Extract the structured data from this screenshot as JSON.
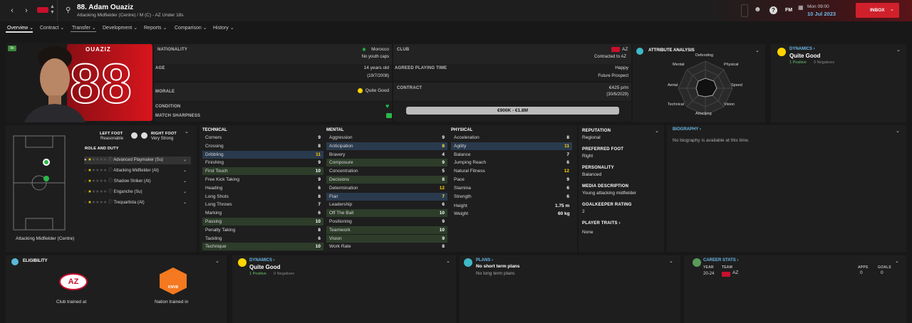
{
  "header": {
    "name": "88. Adam Ouaziz",
    "subtitle": "Attacking Midfielder (Centre) / M (C) - AZ Under 18s",
    "date_time": "Mon 09:00",
    "date": "10 Jul 2023",
    "inbox_label": "INBOX",
    "fm_label": "FM"
  },
  "nav": [
    "Overview",
    "Contract",
    "Transfer",
    "Development",
    "Reports",
    "Comparison",
    "History"
  ],
  "player_card": {
    "badge": "9s",
    "shirt_name": "OUAZIZ",
    "shirt_number": "88"
  },
  "info": {
    "nationality_label": "NATIONALITY",
    "nationality": "Morocco",
    "youth_caps": "No youth caps",
    "club_label": "CLUB",
    "club": "AZ",
    "contracted_to": "Contracted to AZ",
    "age_label": "AGE",
    "age": "14 years old",
    "dob": "(19/7/2008)",
    "playing_time_label": "AGREED PLAYING TIME",
    "playing_time": "Happy",
    "playing_time_sub": "Future Prospect",
    "morale_label": "MORALE",
    "morale": "Quite Good",
    "contract_label": "CONTRACT",
    "wage": "€425 p/m",
    "contract_end": "(30/6/2029)",
    "condition_label": "CONDITION",
    "sharpness_label": "MATCH SHARPNESS",
    "value": "€900K - €1.8M"
  },
  "attribute_analysis": {
    "title": "ATTRIBUTE ANALYSIS",
    "labels": [
      "Defending",
      "Physical",
      "Speed",
      "Vision",
      "Attacking",
      "Technical",
      "Aerial",
      "Mental"
    ]
  },
  "dynamics_top": {
    "title": "DYNAMICS",
    "value": "Quite Good",
    "positive": "1 Positive",
    "negatives": "0 Negatives"
  },
  "positions": {
    "left_foot_label": "LEFT FOOT",
    "left_foot": "Reasonable",
    "right_foot_label": "RIGHT FOOT",
    "right_foot": "Very Strong",
    "role_label": "ROLE AND DUTY",
    "roles": [
      "Advanced Playmaker (Su)",
      "Attacking Midfielder (At)",
      "Shadow Striker (At)",
      "Enganche (Su)",
      "Trequartista (At)"
    ],
    "position_name": "Attacking Midfielder (Centre)"
  },
  "technical": {
    "title": "TECHNICAL",
    "rows": [
      {
        "name": "Corners",
        "value": "9"
      },
      {
        "name": "Crossing",
        "value": "8"
      },
      {
        "name": "Dribbling",
        "value": "11"
      },
      {
        "name": "Finishing",
        "value": "9"
      },
      {
        "name": "First Touch",
        "value": "10"
      },
      {
        "name": "Free Kick Taking",
        "value": "9"
      },
      {
        "name": "Heading",
        "value": "6"
      },
      {
        "name": "Long Shots",
        "value": "8"
      },
      {
        "name": "Long Throws",
        "value": "7"
      },
      {
        "name": "Marking",
        "value": "6"
      },
      {
        "name": "Passing",
        "value": "10"
      },
      {
        "name": "Penalty Taking",
        "value": "8"
      },
      {
        "name": "Tackling",
        "value": "6"
      },
      {
        "name": "Technique",
        "value": "10"
      }
    ]
  },
  "mental": {
    "title": "MENTAL",
    "rows": [
      {
        "name": "Aggression",
        "value": "9"
      },
      {
        "name": "Anticipation",
        "value": "8"
      },
      {
        "name": "Bravery",
        "value": "4"
      },
      {
        "name": "Composure",
        "value": "9"
      },
      {
        "name": "Concentration",
        "value": "5"
      },
      {
        "name": "Decisions",
        "value": "8"
      },
      {
        "name": "Determination",
        "value": "12"
      },
      {
        "name": "Flair",
        "value": "7"
      },
      {
        "name": "Leadership",
        "value": "6"
      },
      {
        "name": "Off The Ball",
        "value": "10"
      },
      {
        "name": "Positioning",
        "value": "9"
      },
      {
        "name": "Teamwork",
        "value": "10"
      },
      {
        "name": "Vision",
        "value": "9"
      },
      {
        "name": "Work Rate",
        "value": "8"
      }
    ]
  },
  "physical": {
    "title": "PHYSICAL",
    "rows": [
      {
        "name": "Acceleration",
        "value": "8"
      },
      {
        "name": "Agility",
        "value": "11"
      },
      {
        "name": "Balance",
        "value": "7"
      },
      {
        "name": "Jumping Reach",
        "value": "6"
      },
      {
        "name": "Natural Fitness",
        "value": "12"
      },
      {
        "name": "Pace",
        "value": "9"
      },
      {
        "name": "Stamina",
        "value": "6"
      },
      {
        "name": "Strength",
        "value": "6"
      }
    ],
    "height_label": "Height",
    "height": "1.75 m",
    "weight_label": "Weight",
    "weight": "60 kg"
  },
  "details": {
    "reputation_label": "REPUTATION",
    "reputation": "Regional",
    "preferred_foot_label": "PREFERRED FOOT",
    "preferred_foot": "Right",
    "personality_label": "PERSONALITY",
    "personality": "Balanced",
    "media_label": "MEDIA DESCRIPTION",
    "media": "Young attacking midfielder",
    "gk_label": "GOALKEEPER RATING",
    "gk": "2",
    "traits_label": "PLAYER TRAITS",
    "traits": "None"
  },
  "biography": {
    "title": "BIOGRAPHY",
    "text": "No biography is available at this time."
  },
  "eligibility": {
    "title": "ELIGIBILITY",
    "club_trained": "Club trained at",
    "nation_trained": "Nation trained in",
    "az_logo": "AZ",
    "knvb_logo": "KNVB"
  },
  "dynamics_bottom": {
    "title": "DYNAMICS",
    "value": "Quite Good",
    "positive": "1 Positive",
    "negatives": "0 Negatives"
  },
  "plans": {
    "title": "PLANS",
    "short": "No short term plans",
    "long": "No long term plans"
  },
  "career": {
    "title": "CAREER STATS",
    "year_label": "YEAR",
    "team_label": "TEAM",
    "apps_label": "APPS",
    "goals_label": "GOALS",
    "year": "20-24",
    "team": "AZ",
    "apps": "0",
    "goals": "0"
  },
  "colors": {
    "accent": "#c8102e",
    "positive": "#6cc26a",
    "highlight": "#ffe44d"
  }
}
